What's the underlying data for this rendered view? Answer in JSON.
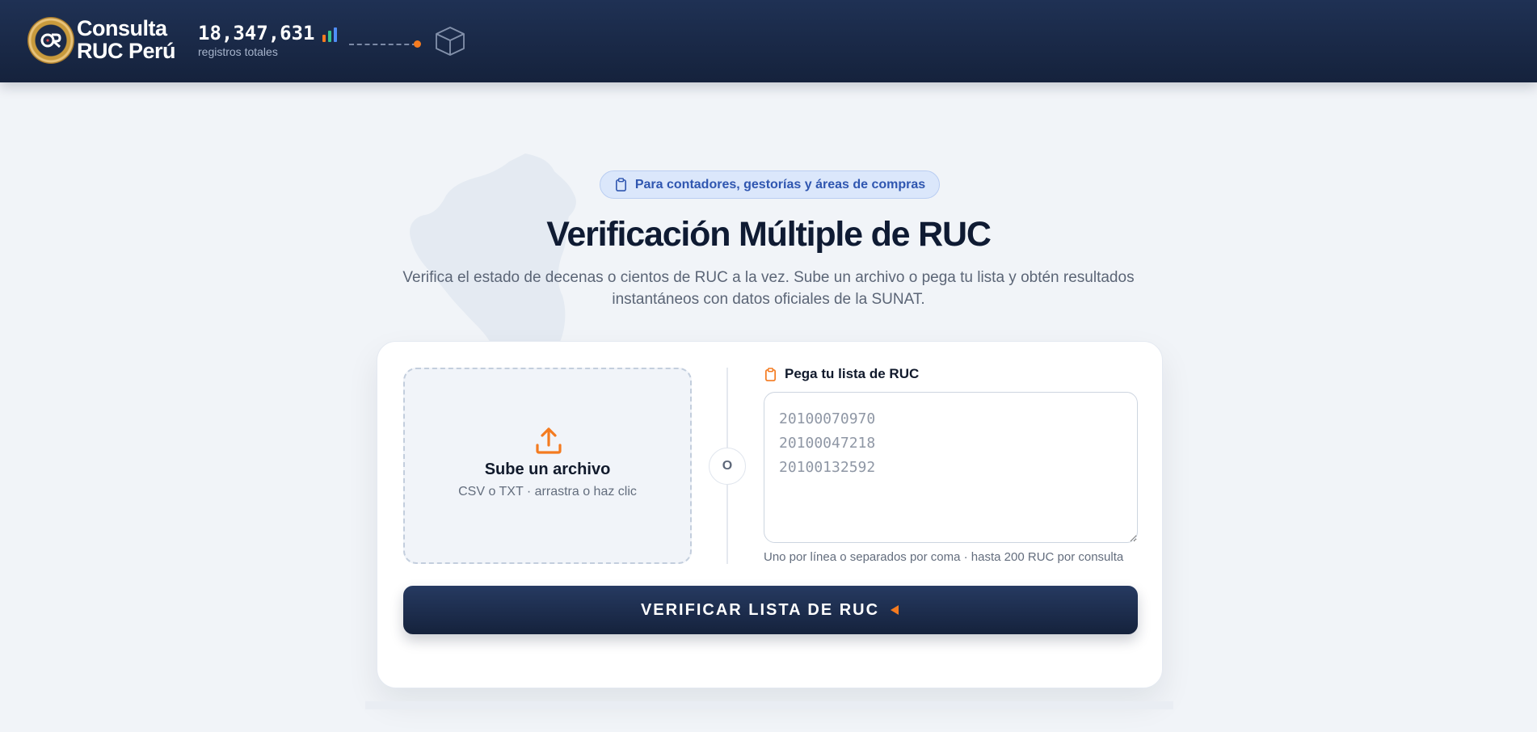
{
  "header": {
    "brand_line1": "Consulta",
    "brand_line2": "RUC Perú",
    "total_count": "18,347,631",
    "total_label": "registros totales",
    "colors": {
      "bg": "#1b2a48",
      "accent": "#f47b20"
    },
    "icons": [
      "logo-seal",
      "bar-chart-icon",
      "box-icon"
    ]
  },
  "hero": {
    "pill_text": "Para contadores, gestorías y áreas de compras",
    "title": "Verificación Múltiple de RUC",
    "subtitle": "Verifica el estado de decenas o cientos de RUC a la vez. Sube un archivo o pega tu lista y obtén resultados instantáneos con datos oficiales de la SUNAT."
  },
  "upload": {
    "title": "Sube un archivo",
    "subtitle": "CSV o TXT · arrastra o haz clic"
  },
  "divider_text": "O",
  "paste": {
    "label": "Pega tu lista de RUC",
    "placeholder": "20100070970\n20100047218\n20100132592",
    "value": "",
    "hint": "Uno por línea o separados por coma · hasta 200 RUC por consulta"
  },
  "actions": {
    "verify_label": "VERIFICAR LISTA DE RUC"
  }
}
